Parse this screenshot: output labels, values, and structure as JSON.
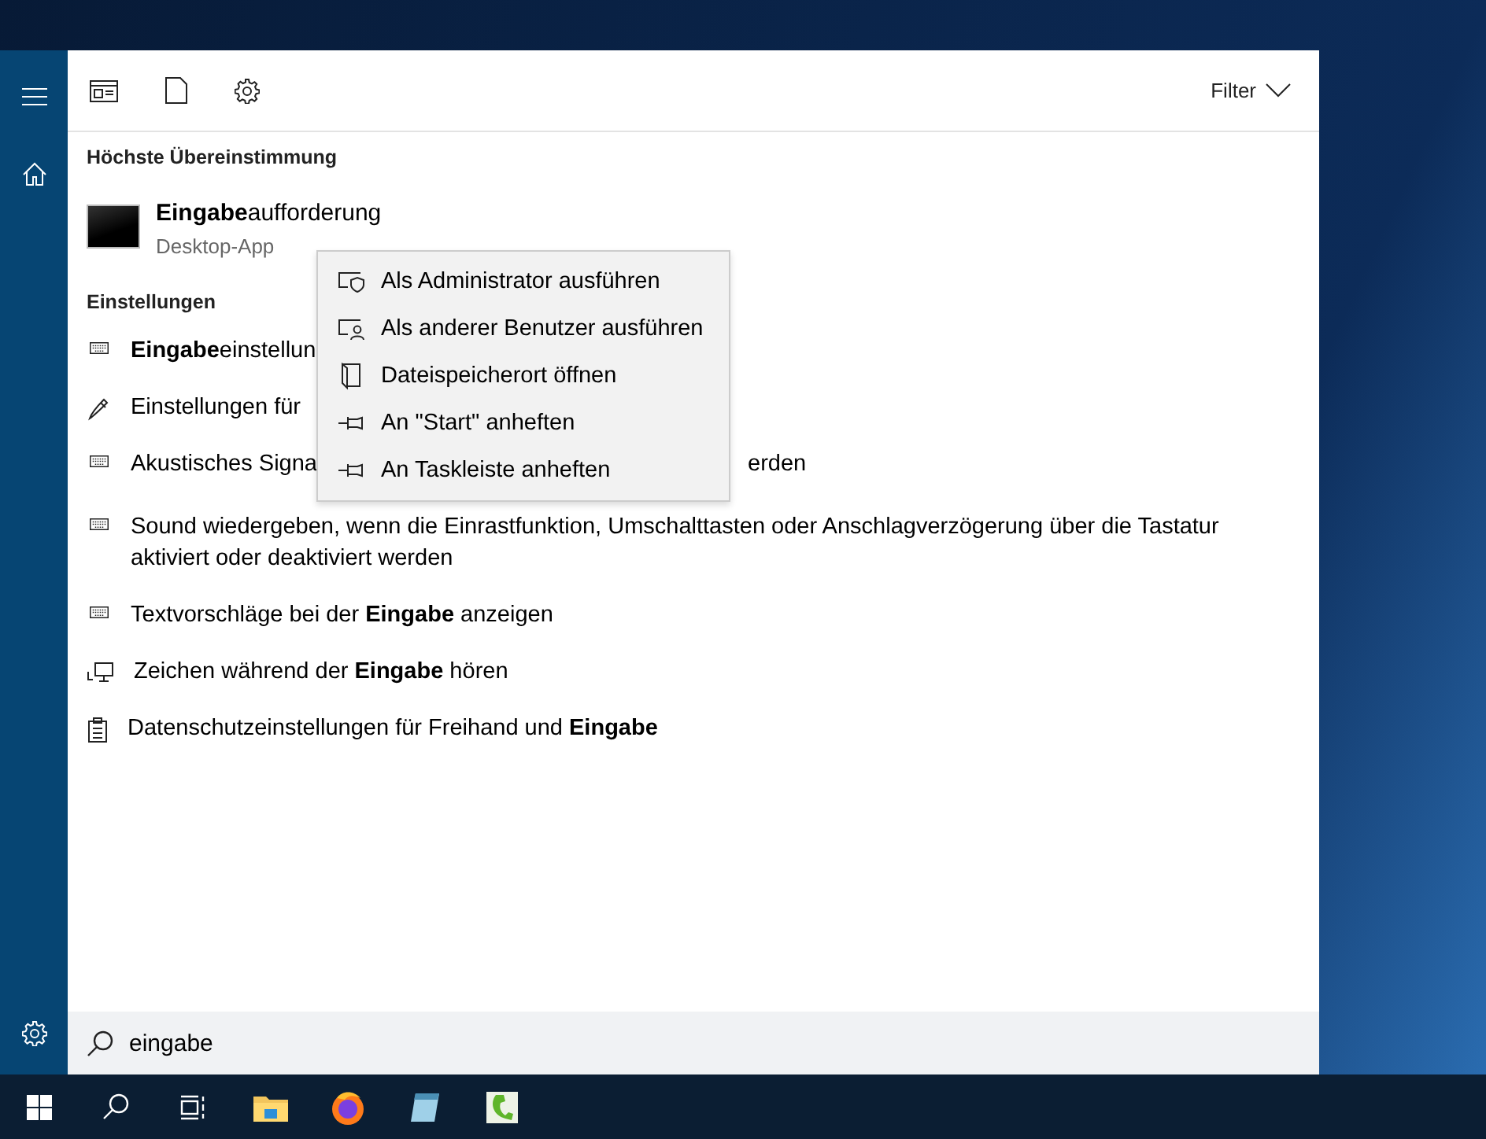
{
  "toolbar": {
    "filter_label": "Filter"
  },
  "best_match": {
    "heading": "Höchste Übereinstimmung",
    "title": "**Eingabe**aufforderung",
    "subtitle": "Desktop-App"
  },
  "settings": {
    "heading": "Einstellungen",
    "items": [
      {
        "kind": "keyboard",
        "text": "**Eingabe**einstellun"
      },
      {
        "kind": "pen",
        "text": "Einstellungen für"
      },
      {
        "kind": "keyboard",
        "text": "Akustisches Signa",
        "text_after_menu": "erden"
      },
      {
        "kind": "keyboard",
        "text": "Sound wiedergeben, wenn die Einrastfunktion, Umschalttasten oder Anschlagverzögerung über die Tastatur aktiviert oder deaktiviert werden"
      },
      {
        "kind": "keyboard",
        "text": "Textvorschläge bei der **Eingabe** anzeigen"
      },
      {
        "kind": "monitor",
        "text": "Zeichen während der **Eingabe** hören"
      },
      {
        "kind": "clipboard",
        "text": "Datenschutzeinstellungen für Freihand und **Eingabe**"
      }
    ]
  },
  "context_menu": [
    {
      "kind": "shield",
      "label": "Als Administrator ausführen"
    },
    {
      "kind": "user",
      "label": "Als anderer Benutzer ausführen"
    },
    {
      "kind": "folder",
      "label": "Dateispeicherort öffnen"
    },
    {
      "kind": "pin",
      "label": "An \"Start\" anheften"
    },
    {
      "kind": "pin",
      "label": "An Taskleiste anheften"
    }
  ],
  "search": {
    "value": "eingabe"
  }
}
